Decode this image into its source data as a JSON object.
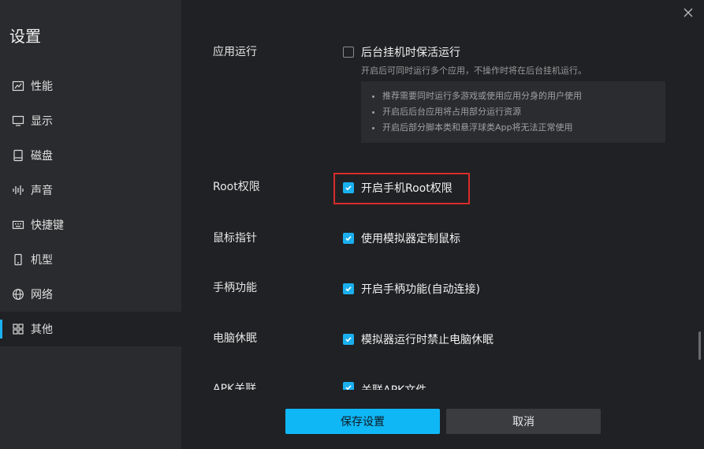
{
  "sidebar": {
    "title": "设置",
    "items": [
      {
        "label": "性能",
        "icon": "performance-chart-icon"
      },
      {
        "label": "显示",
        "icon": "monitor-icon"
      },
      {
        "label": "磁盘",
        "icon": "disk-icon"
      },
      {
        "label": "声音",
        "icon": "sound-wave-icon"
      },
      {
        "label": "快捷键",
        "icon": "keyboard-icon"
      },
      {
        "label": "机型",
        "icon": "phone-icon"
      },
      {
        "label": "网络",
        "icon": "globe-icon"
      },
      {
        "label": "其他",
        "icon": "grid-icon",
        "active": true
      }
    ]
  },
  "main": {
    "sections": [
      {
        "label": "应用运行",
        "option": "后台挂机时保活运行",
        "checked": false
      },
      {
        "label": "Root权限",
        "option": "开启手机Root权限",
        "checked": true
      },
      {
        "label": "鼠标指针",
        "option": "使用模拟器定制鼠标",
        "checked": true
      },
      {
        "label": "手柄功能",
        "option": "开启手柄功能(自动连接)",
        "checked": true
      },
      {
        "label": "电脑休眠",
        "option": "模拟器运行时禁止电脑休眠",
        "checked": true
      },
      {
        "label": "APK关联",
        "option": "关联APK文件",
        "checked": true
      }
    ],
    "app_run_desc": "开启后可同时运行多个应用，不操作时将在后台挂机运行。",
    "tips": [
      "推荐需要同时运行多游戏或使用应用分身的用户使用",
      "开启后后台应用将占用部分运行资源",
      "开启后部分脚本类和悬浮球类App将无法正常使用"
    ]
  },
  "footer": {
    "save_label": "保存设置",
    "cancel_label": "取消"
  },
  "colors": {
    "accent": "#1ab0f0",
    "highlight_border": "#d92b2b",
    "background": "#202124",
    "sidebar": "#2a2b2e"
  }
}
